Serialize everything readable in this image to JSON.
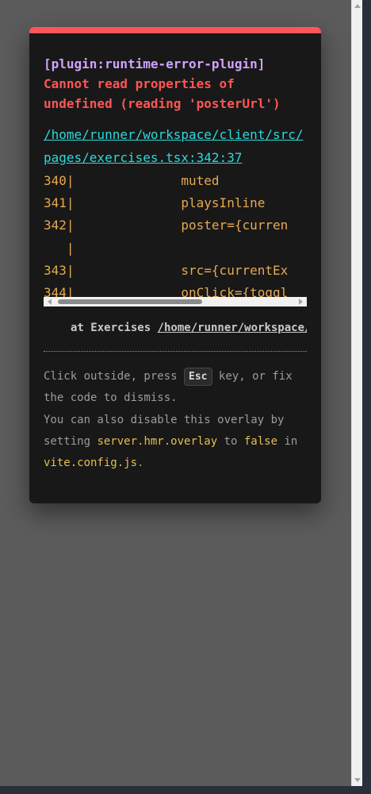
{
  "overlay": {
    "plugin": "[plugin:runtime-error-plugin]",
    "message": "Cannot read properties of\nundefined (reading 'posterUrl')",
    "file": "/home/runner/workspace/client/src/pages/exercises.tsx:342:37",
    "frame": "340|              muted\n341|              playsInline\n342|              poster={curren\n   |\n343|              src={currentEx\n344|              onClick={toggl",
    "stack_prefix": "at Exercises ",
    "stack_location": "/home/runner/workspace/client/src/pages/exercises.tsx",
    "tip": {
      "t1": "Click outside, press ",
      "key": "Esc",
      "t2": " key, or fix the code to dismiss.",
      "t3": "You can also disable this overlay by setting ",
      "code1": "server.hmr.overlay",
      "t4": " to ",
      "code2": "false",
      "t5": " in ",
      "code3": "vite.config.js",
      "t6": "."
    }
  },
  "colors": {
    "accent": "#ff5555",
    "plugin": "#cfa4ff",
    "file_link": "#2dd9da",
    "frame_code": "#e5a953"
  }
}
